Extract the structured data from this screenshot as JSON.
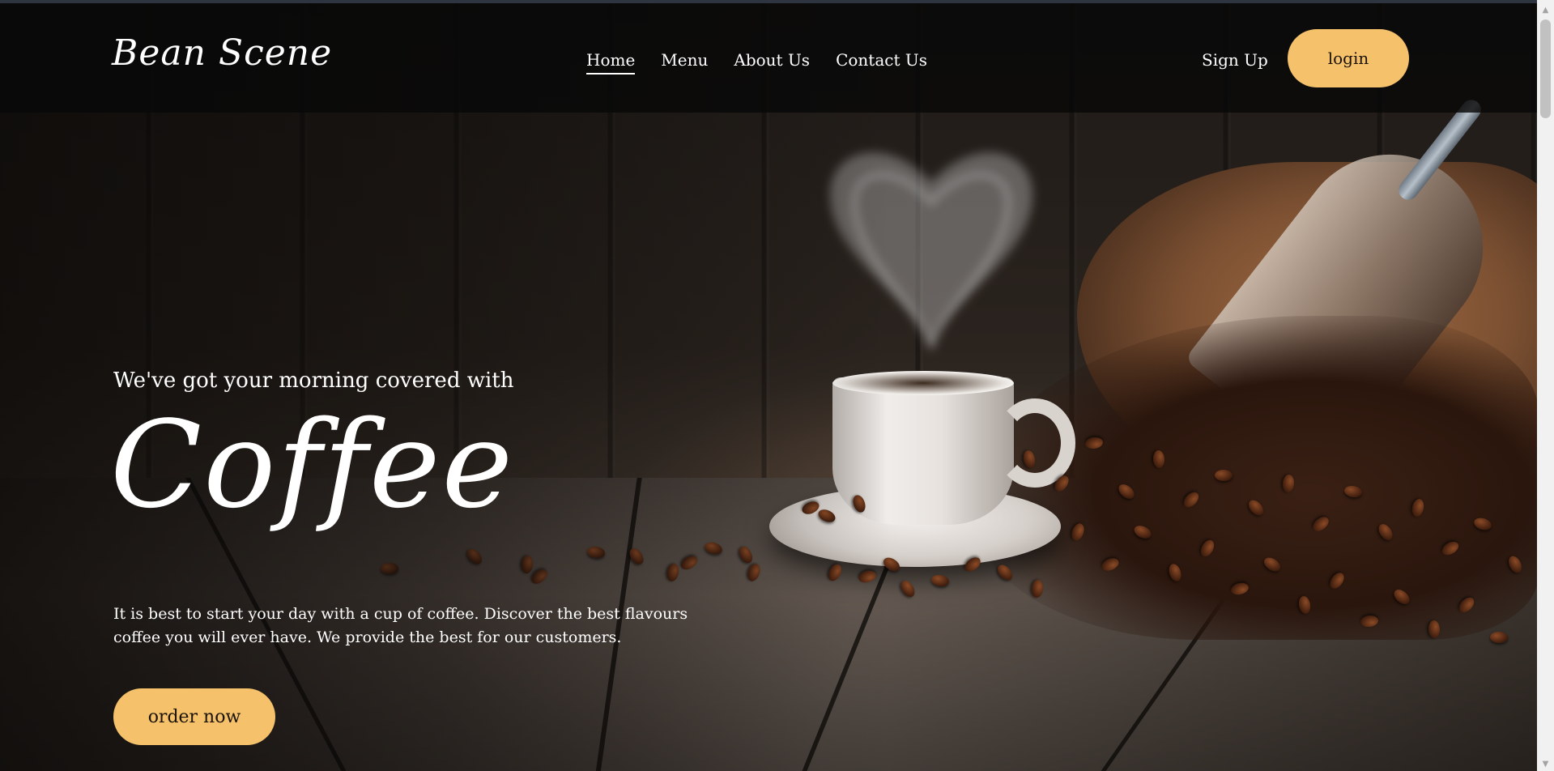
{
  "brand": {
    "logo_text": "Bean Scene"
  },
  "nav": {
    "links": [
      {
        "label": "Home",
        "active": true
      },
      {
        "label": "Menu",
        "active": false
      },
      {
        "label": "About Us",
        "active": false
      },
      {
        "label": "Contact Us",
        "active": false
      }
    ],
    "signup_label": "Sign Up",
    "login_label": "login"
  },
  "hero": {
    "tagline": "We've got your morning covered with",
    "headline": "Coffee",
    "description": "It is best to start your day with a cup of coffee. Discover the best flavours coffee you will ever have. We provide the best for our customers.",
    "cta_label": "order now",
    "background_image": "coffee-cup-beans-photo"
  },
  "colors": {
    "accent": "#f5c26b",
    "navbar_bg": "#0a0a0a",
    "text": "#ffffff"
  },
  "icons": {
    "scroll_up": "scroll-up-arrow-icon",
    "scroll_down": "scroll-down-arrow-icon"
  }
}
